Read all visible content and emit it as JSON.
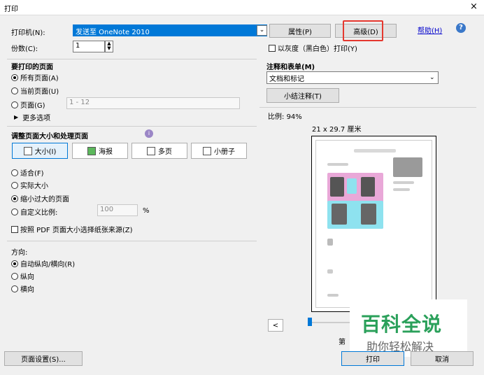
{
  "window": {
    "title": "打印",
    "close": "×"
  },
  "printer": {
    "label": "打印机(N):",
    "value": "发送至 OneNote 2010",
    "properties_button": "属性(P)",
    "advanced_button": "高级(D)",
    "help_link": "帮助(H)",
    "copies_label": "份数(C):",
    "copies_value": "1",
    "grayscale_label": "以灰度（黑白色）打印(Y)"
  },
  "pages": {
    "heading": "要打印的页面",
    "all": "所有页面(A)",
    "current": "当前页面(U)",
    "range": "页面(G)",
    "range_value": "1 - 12",
    "more": "更多选项"
  },
  "sizing": {
    "heading": "调整页面大小和处理页面",
    "tabs": [
      "大小(I)",
      "海报",
      "多页",
      "小册子"
    ],
    "fit": "适合(F)",
    "actual": "实际大小",
    "shrink": "缩小过大的页面",
    "custom": "自定义比例:",
    "custom_value": "100",
    "percent": "%",
    "paper_source": "按照 PDF 页面大小选择纸张来源(Z)"
  },
  "orientation": {
    "heading": "方向:",
    "auto": "自动纵向/横向(R)",
    "portrait": "纵向",
    "landscape": "横向"
  },
  "comments": {
    "heading": "注释和表单(M)",
    "value": "文档和标记",
    "summarize_button": "小结注释(T)"
  },
  "preview": {
    "scale_label": "比例:",
    "scale_value": "94%",
    "paper_size": "21 x 29.7 厘米",
    "prev_button": "<",
    "page_prefix": "第"
  },
  "footer": {
    "page_setup_button": "页面设置(S)...",
    "print_button": "打印",
    "cancel_button": "取消"
  },
  "watermark": {
    "line1": "百科全说",
    "line2": "助你轻松解决"
  },
  "colors": {
    "selection": "#0078d7",
    "highlight": "#e5382f",
    "link": "#0000cc"
  }
}
